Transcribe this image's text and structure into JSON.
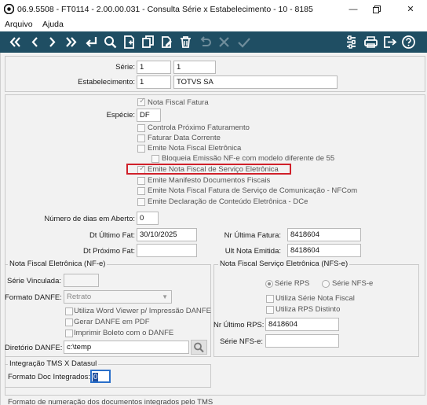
{
  "window": {
    "title": "06.9.5508 - FT0114 - 2.00.00.031 - Consulta Série x Estabelecimento - 10 - 8185",
    "controls": [
      "minimize-icon",
      "restore-icon",
      "close-icon"
    ]
  },
  "menu": {
    "items": [
      {
        "label": "Arquivo"
      },
      {
        "label": "Ajuda"
      }
    ]
  },
  "toolbar": {
    "left_icons": [
      "first-record-icon",
      "previous-record-icon",
      "next-record-icon",
      "last-record-icon",
      "goto-icon",
      "search-icon",
      "new-document-icon",
      "copy-icon",
      "edit-icon",
      "delete-icon",
      "undo-icon",
      "cancel-icon",
      "confirm-icon"
    ],
    "right_icons": [
      "settings-icon",
      "print-icon",
      "exit-icon",
      "help-icon"
    ],
    "bg_color": "#1f4e63"
  },
  "header": {
    "serie_label": "Série:",
    "serie_value1": "1",
    "serie_value2": "1",
    "estab_label": "Estabelecimento:",
    "estab_code": "1",
    "estab_name": "TOTVS SA"
  },
  "options": {
    "nota_fiscal_fatura": "Nota Fiscal Fatura",
    "especie_label": "Espécie:",
    "especie_value": "DF",
    "controla_proximo": "Controla Próximo Faturamento",
    "faturar_data": "Faturar Data Corrente",
    "emite_nfe": "Emite Nota Fiscal Eletrônica",
    "bloqueia_emissao": "Bloqueia Emissão NF-e com modelo diferente de 55",
    "emite_nfse": "Emite Nota Fiscal de Serviço Eletrônica",
    "emite_manifesto": "Emite Manifesto Documentos Fiscais",
    "emite_nfcom": "Emite Nota Fiscal Fatura de Serviço de Comunicação - NFCom",
    "emite_dce": "Emite Declaração de Conteúdo Eletrônica - DCe"
  },
  "dates": {
    "dias_label": "Número de dias em Aberto:",
    "dias_value": "0",
    "ult_fat_label": "Dt Último Fat:",
    "ult_fat_value": "30/10/2025",
    "prox_fat_label": "Dt Próximo Fat:",
    "prox_fat_value": "",
    "nr_ult_fatura_label": "Nr Última Fatura:",
    "nr_ult_fatura_value": "8418604",
    "ult_nota_label": "Ult Nota Emitida:",
    "ult_nota_value": "8418604"
  },
  "nfe": {
    "group_title": "Nota Fiscal Eletrônica (NF-e)",
    "serie_vinc_label": "Série Vinculada:",
    "serie_vinc_value": "",
    "formato_label": "Formato DANFE:",
    "formato_value": "Retrato",
    "word_viewer": "Utiliza Word Viewer p/ Impressão DANFE",
    "gerar_pdf": "Gerar DANFE em PDF",
    "imprimir_boleto": "Imprimir Boleto com o DANFE",
    "diretorio_label": "Diretório DANFE:",
    "diretorio_value": "c:\\temp"
  },
  "nfse": {
    "group_title": "Nota Fiscal Serviço Eletrônica (NFS-e)",
    "serie_rps": "Série RPS",
    "serie_nfse": "Série NFS-e",
    "utiliza_serie_nota": "Utiliza Série Nota Fiscal",
    "utiliza_rps_distinto": "Utiliza RPS Distinto",
    "nr_ult_rps_label": "Nr Último RPS:",
    "nr_ult_rps_value": "8418604",
    "serie_nfse_label": "Série NFS-e:",
    "serie_nfse_value": ""
  },
  "tms": {
    "group_title": "Integração TMS X Datasul",
    "formato_label": "Formato Doc Integrados:",
    "formato_value": "0",
    "footer_text": "Formato de numeração dos documentos integrados pelo TMS"
  },
  "colors": {
    "highlight": "#d0202a",
    "toolbar": "#1f4e63"
  }
}
